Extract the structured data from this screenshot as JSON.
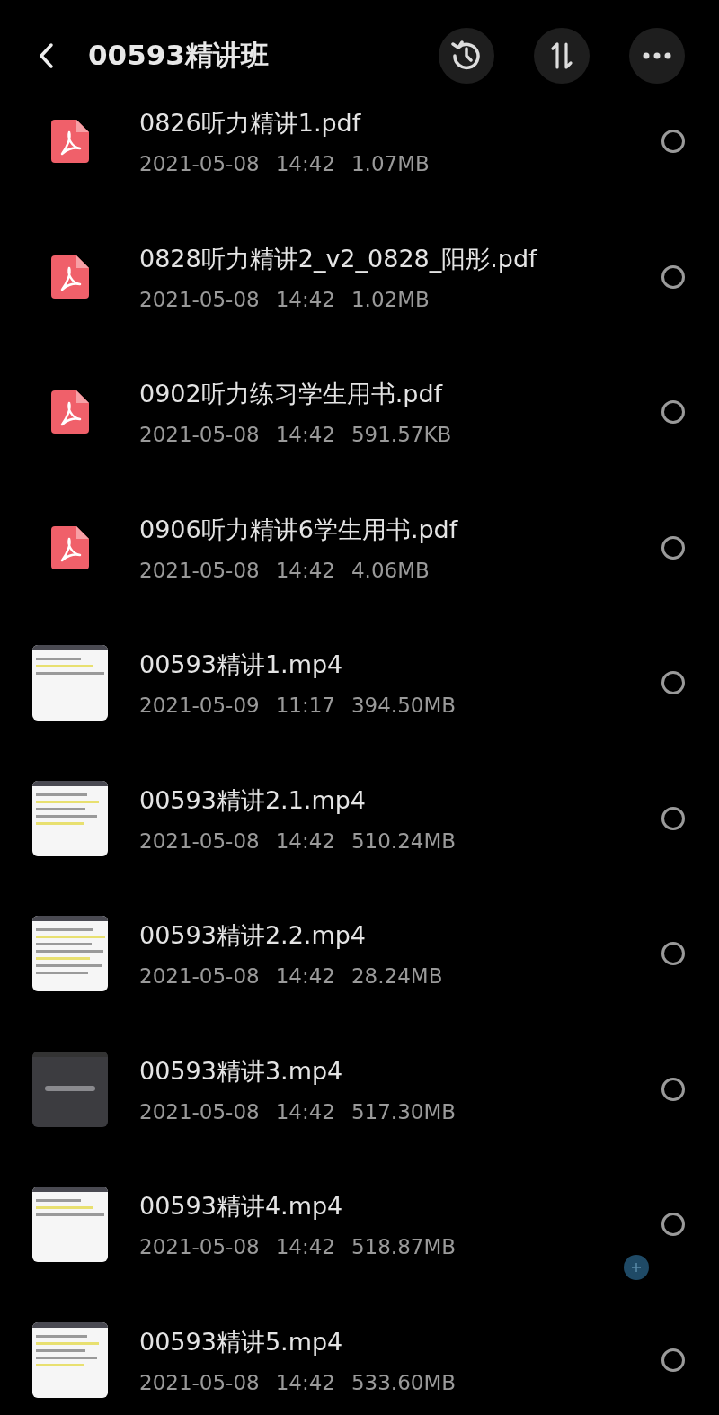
{
  "header": {
    "title": "00593精讲班"
  },
  "files": [
    {
      "kind": "pdf",
      "name": "0826听力精讲1.pdf",
      "date": "2021-05-08",
      "time": "14:42",
      "size": "1.07MB",
      "selected": false
    },
    {
      "kind": "pdf",
      "name": "0828听力精讲2_v2_0828_阳彤.pdf",
      "date": "2021-05-08",
      "time": "14:42",
      "size": "1.02MB",
      "selected": false
    },
    {
      "kind": "pdf",
      "name": "0902听力练习学生用书.pdf",
      "date": "2021-05-08",
      "time": "14:42",
      "size": "591.57KB",
      "selected": false
    },
    {
      "kind": "pdf",
      "name": "0906听力精讲6学生用书.pdf",
      "date": "2021-05-08",
      "time": "14:42",
      "size": "4.06MB",
      "selected": false
    },
    {
      "kind": "video",
      "name": "00593精讲1.mp4",
      "date": "2021-05-09",
      "time": "11:17",
      "size": "394.50MB",
      "selected": false
    },
    {
      "kind": "video",
      "name": "00593精讲2.1.mp4",
      "date": "2021-05-08",
      "time": "14:42",
      "size": "510.24MB",
      "selected": false
    },
    {
      "kind": "video",
      "name": "00593精讲2.2.mp4",
      "date": "2021-05-08",
      "time": "14:42",
      "size": "28.24MB",
      "selected": false
    },
    {
      "kind": "video",
      "name": "00593精讲3.mp4",
      "date": "2021-05-08",
      "time": "14:42",
      "size": "517.30MB",
      "selected": false
    },
    {
      "kind": "video",
      "name": "00593精讲4.mp4",
      "date": "2021-05-08",
      "time": "14:42",
      "size": "518.87MB",
      "selected": false
    },
    {
      "kind": "video",
      "name": "00593精讲5.mp4",
      "date": "2021-05-08",
      "time": "14:42",
      "size": "533.60MB",
      "selected": false
    }
  ]
}
